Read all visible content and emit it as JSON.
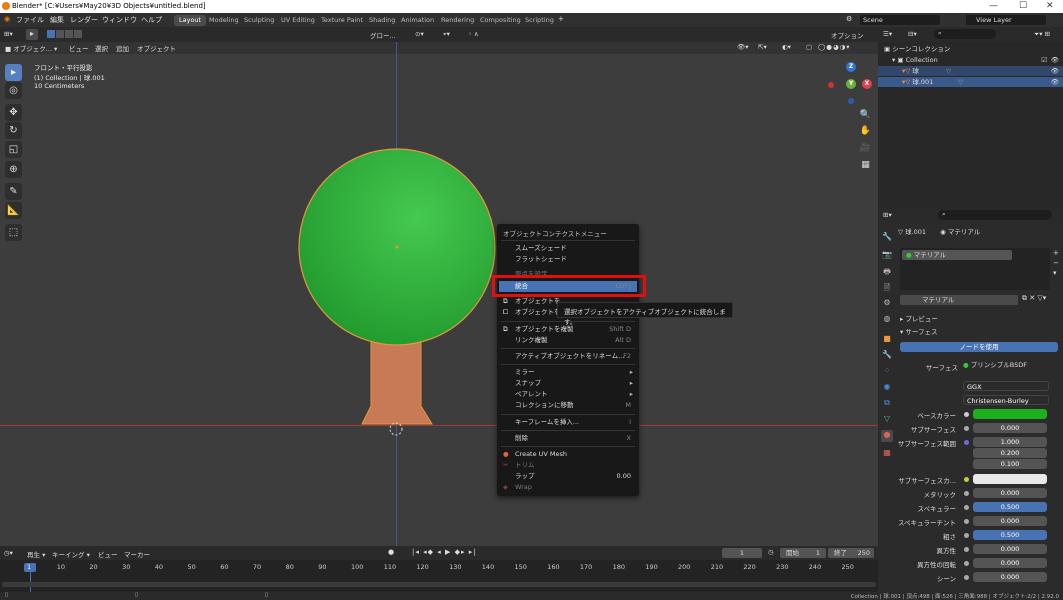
{
  "titlebar": {
    "title": "Blender* [C:¥Users¥May20¥3D Objects¥untitled.blend]",
    "min": "—",
    "max": "☐",
    "close": "✕"
  },
  "menu": [
    "ファイル",
    "編集",
    "レンダー",
    "ウィンドウ",
    "ヘルプ"
  ],
  "workspaces": [
    "Layout",
    "Modeling",
    "Sculpting",
    "UV Editing",
    "Texture Paint",
    "Shading",
    "Animation",
    "Rendering",
    "Compositing",
    "Scripting"
  ],
  "scene": {
    "label": "Scene",
    "view_layer": "View Layer"
  },
  "header3d": {
    "mode": "オブジェク...",
    "view": "ビュー",
    "select": "選択",
    "add": "追加",
    "object": "オブジェクト",
    "orient": "グロー...",
    "options": "オプション"
  },
  "viewport_info": {
    "line1": "フロント・平行投影",
    "line2": "(1) Collection | 球.001",
    "line3": "10 Centimeters"
  },
  "context_menu": {
    "title": "オブジェクトコンテクストメニュー",
    "items": [
      {
        "label": "スムーズシェード",
        "shortcut": ""
      },
      {
        "label": "フラットシェード",
        "shortcut": ""
      },
      {
        "label": "原点を設定",
        "shortcut": ""
      },
      {
        "label": "統合",
        "shortcut": "Ctrl J"
      },
      {
        "label": "オブジェクトを",
        "shortcut": ""
      },
      {
        "label": "オブジェクトを",
        "shortcut": ""
      },
      {
        "label": "オブジェクトを複製",
        "shortcut": "Shift D"
      },
      {
        "label": "リンク複製",
        "shortcut": "Alt D"
      },
      {
        "label": "アクティブオブジェクトをリネーム...",
        "shortcut": "F2"
      },
      {
        "label": "ミラー",
        "shortcut": ""
      },
      {
        "label": "スナップ",
        "shortcut": ""
      },
      {
        "label": "ペアレント",
        "shortcut": ""
      },
      {
        "label": "コレクションに移動",
        "shortcut": "M"
      },
      {
        "label": "キーフレームを挿入...",
        "shortcut": "I"
      },
      {
        "label": "削除",
        "shortcut": "X"
      },
      {
        "label": "Create UV Mesh",
        "shortcut": ""
      },
      {
        "label": "トリム",
        "shortcut": ""
      },
      {
        "label": "ラップ",
        "shortcut": "0.00"
      },
      {
        "label": "Wrap",
        "shortcut": ""
      }
    ]
  },
  "tooltip": "選択オブジェクトをアクティブオブジェクトに統合します。",
  "outliner": {
    "scene_collection": "シーンコレクション",
    "collection": "Collection",
    "objects": [
      "球",
      "球.001"
    ]
  },
  "properties": {
    "object": "球.001",
    "material_tab": "マテリアル",
    "slot": "マテリアル",
    "material_name": "マテリアル",
    "preview": "プレビュー",
    "surface_panel": "サーフェス",
    "use_nodes": "ノードを使用",
    "surface_label": "サーフェス",
    "surface_value": "プリンシプルBSDF",
    "distribution": "GGX",
    "subsurface_method": "Christensen-Burley",
    "rows": [
      {
        "label": "ベースカラー",
        "value": ""
      },
      {
        "label": "サブサーフェス",
        "value": "0.000"
      },
      {
        "label": "サブサーフェス範囲",
        "value": "1.000"
      },
      {
        "label": "",
        "value": "0.200"
      },
      {
        "label": "",
        "value": "0.100"
      },
      {
        "label": "サブサーフェスカ...",
        "value": ""
      },
      {
        "label": "メタリック",
        "value": "0.000"
      },
      {
        "label": "スペキュラー",
        "value": "0.500"
      },
      {
        "label": "スペキュラーチント",
        "value": "0.000"
      },
      {
        "label": "粗さ",
        "value": "0.500"
      },
      {
        "label": "異方性",
        "value": "0.000"
      },
      {
        "label": "異方性の回転",
        "value": "0.000"
      },
      {
        "label": "シーン",
        "value": "0.000"
      }
    ]
  },
  "timeline": {
    "playback": "再生",
    "keying": "キーイング",
    "view": "ビュー",
    "marker": "マーカー",
    "current": "1",
    "start_label": "開始",
    "start": "1",
    "end_label": "終了",
    "end": "250",
    "frames": [
      "1",
      "10",
      "20",
      "30",
      "40",
      "50",
      "60",
      "70",
      "80",
      "90",
      "100",
      "110",
      "120",
      "130",
      "140",
      "150",
      "160",
      "170",
      "180",
      "190",
      "200",
      "210",
      "220",
      "230",
      "240",
      "250"
    ]
  },
  "statusbar": "Collection | 球.001 | 頂点:498 | 面:526 | 三角面:988 | オブジェクト:2/2 | 2.92.0",
  "colors": {
    "accent": "#4772b3",
    "sphere": "#2fae3a",
    "trunk": "#c87a56",
    "highlight": "#e01010"
  }
}
